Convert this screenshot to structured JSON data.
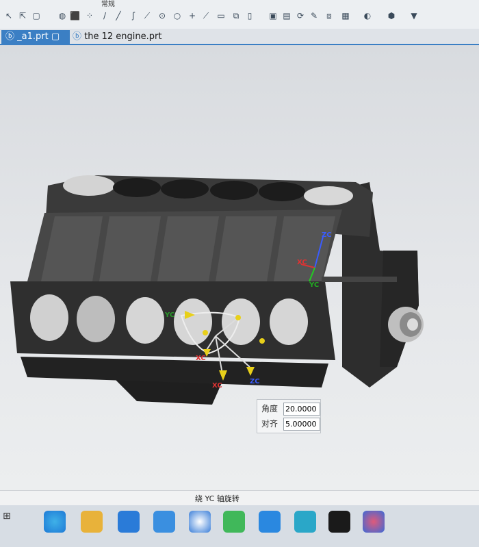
{
  "toolbar": {
    "top_label": "常规",
    "icons": [
      "pointer-icon",
      "select-icon",
      "box-select-icon",
      "sphere-icon",
      "cube-icon",
      "points-icon",
      "line-icon",
      "arc-icon",
      "spline-icon",
      "circle-icon",
      "circle-point-icon",
      "cross-icon",
      "diagonal-icon",
      "rect-icon",
      "copy-icon",
      "view-icon",
      "display-icon",
      "rotate-icon",
      "brush-icon",
      "layer-icon",
      "table-icon",
      "render-icon",
      "part-icon",
      "shading-icon"
    ]
  },
  "tabs": [
    {
      "label": "_a1.prt",
      "active": true
    },
    {
      "label": "the 12 engine.prt",
      "active": false
    }
  ],
  "viewport": {
    "csys_labels": {
      "zc_top": "ZC",
      "xc_top": "XC",
      "yc_top": "YC",
      "yc": "YC",
      "xc": "XC",
      "zc": "ZC",
      "xc2": "XC"
    },
    "popup": {
      "angle_label": "角度",
      "angle_value": "20.0000",
      "align_label": "对齐",
      "align_value": "5.00000"
    }
  },
  "status": {
    "text": "绕 YC 轴旋转"
  },
  "taskbar": {
    "apps": [
      "edge-icon",
      "file-explorer-icon",
      "store-icon",
      "mail-icon",
      "browser-icon",
      "wechat-icon",
      "app-icon",
      "ccleaner-icon",
      "other-icon",
      "nx-icon"
    ]
  }
}
